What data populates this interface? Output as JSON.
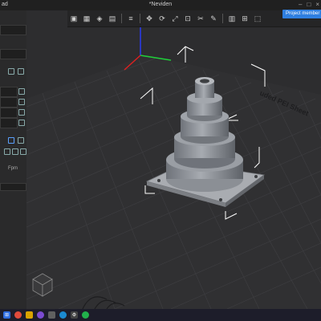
{
  "titlebar": {
    "left_text": "ad",
    "title": "*Neviden",
    "controls": [
      "–",
      "□",
      "×"
    ]
  },
  "project_button": "Project member",
  "sidebar": {
    "sections": [
      {
        "label": "Fpm",
        "value": ""
      }
    ]
  },
  "bed_label": "uded PEI Sheet",
  "toolbar": {
    "buttons": [
      "cube",
      "grid",
      "cube2",
      "layers",
      "orient",
      "move",
      "rotate",
      "scale",
      "cut",
      "paint",
      "arrange",
      "split",
      "view1",
      "view2",
      "view3"
    ]
  },
  "taskbar": {
    "icons": [
      "windows",
      "chrome",
      "files",
      "viber",
      "app",
      "edge",
      "gear",
      "whatsapp"
    ]
  }
}
